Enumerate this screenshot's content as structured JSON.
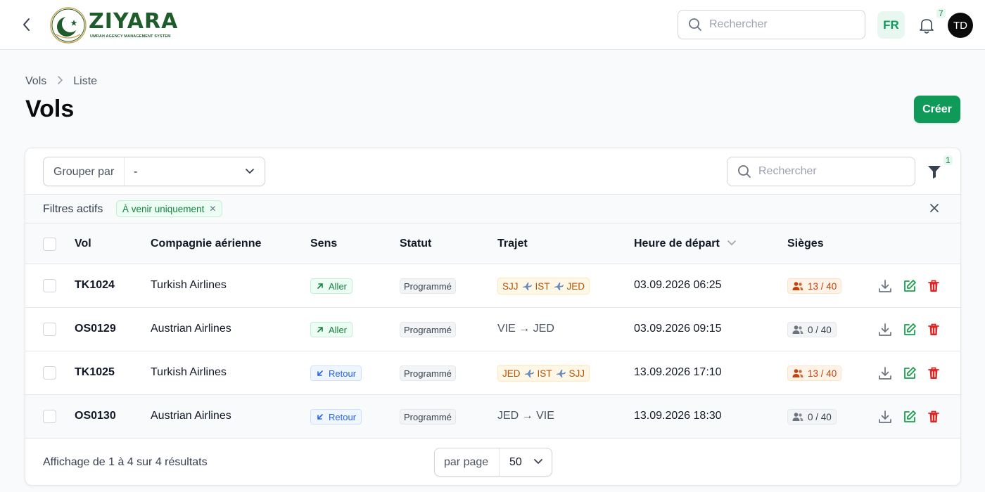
{
  "app": {
    "logo_title": "ZIYARA",
    "logo_subtitle": "UMRAH AGENCY MANAGEMENT SYSTEM",
    "search_placeholder": "Rechercher",
    "language": "FR",
    "notifications_count": "7",
    "user_initials": "TD",
    "brand_color": "#0f9a5a"
  },
  "breadcrumb": {
    "parent": "Vols",
    "current": "Liste"
  },
  "page": {
    "title": "Vols",
    "create_label": "Créer"
  },
  "toolbar": {
    "group_by_label": "Grouper par",
    "group_by_value": "-",
    "search_placeholder": "Rechercher",
    "filter_count": "1"
  },
  "active_filters": {
    "label": "Filtres actifs",
    "chips": [
      {
        "label": "À venir uniquement"
      }
    ]
  },
  "table": {
    "columns": {
      "vol": "Vol",
      "company": "Compagnie aérienne",
      "sens": "Sens",
      "statut": "Statut",
      "trajet": "Trajet",
      "depart": "Heure de départ",
      "seats": "Sièges"
    },
    "rows": [
      {
        "vol": "TK1024",
        "company": "Turkish Airlines",
        "sens": "Aller",
        "statut": "Programmé",
        "trajet_stops": [
          "SJJ",
          "IST",
          "JED"
        ],
        "trajet": "",
        "depart": "03.09.2026 06:25",
        "seats": "13 / 40"
      },
      {
        "vol": "OS0129",
        "company": "Austrian Airlines",
        "sens": "Aller",
        "statut": "Programmé",
        "trajet_stops": [],
        "trajet": "VIE → JED",
        "depart": "03.09.2026 09:15",
        "seats": "0 / 40"
      },
      {
        "vol": "TK1025",
        "company": "Turkish Airlines",
        "sens": "Retour",
        "statut": "Programmé",
        "trajet_stops": [
          "JED",
          "IST",
          "SJJ"
        ],
        "trajet": "",
        "depart": "13.09.2026 17:10",
        "seats": "13 / 40"
      },
      {
        "vol": "OS0130",
        "company": "Austrian Airlines",
        "sens": "Retour",
        "statut": "Programmé",
        "trajet_stops": [],
        "trajet": "JED → VIE",
        "depart": "13.09.2026 18:30",
        "seats": "0 / 40"
      }
    ]
  },
  "pagination": {
    "summary": "Affichage de 1 à 4 sur 4 résultats",
    "per_page_label": "par page",
    "per_page_value": "50"
  },
  "icons": {
    "back": "chevron-left-icon",
    "search": "search-icon",
    "bell": "bell-icon",
    "filter": "funnel-icon",
    "download": "download-icon",
    "edit": "edit-icon",
    "delete": "trash-icon",
    "seats": "users-icon"
  }
}
